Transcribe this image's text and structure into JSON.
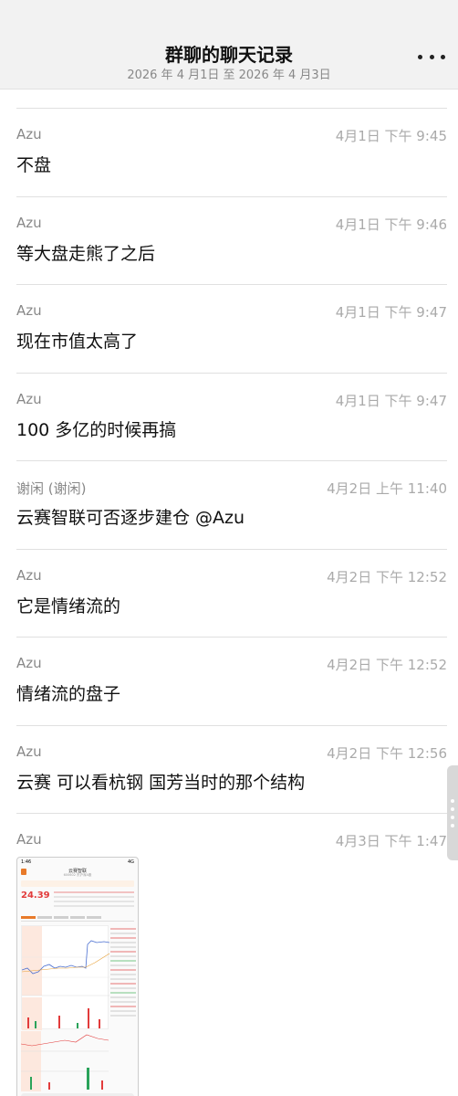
{
  "header": {
    "title": "群聊的聊天记录",
    "subtitle": "2026 年 4 月1日 至 2026 年 4 月3日",
    "more_icon": "more-horizontal-icon"
  },
  "messages": [
    {
      "sender": "Azu",
      "time": "4月1日 下午 9:45",
      "text": "不盘"
    },
    {
      "sender": "Azu",
      "time": "4月1日 下午 9:46",
      "text": "等大盘走熊了之后"
    },
    {
      "sender": "Azu",
      "time": "4月1日 下午 9:47",
      "text": "现在市值太高了"
    },
    {
      "sender": "Azu",
      "time": "4月1日 下午 9:47",
      "text": "100 多亿的时候再搞"
    },
    {
      "sender": "谢闲 (谢闲)",
      "time": "4月2日 上午 11:40",
      "text": "云赛智联可否逐步建仓 @Azu"
    },
    {
      "sender": "Azu",
      "time": "4月2日 下午 12:52",
      "text": "它是情绪流的"
    },
    {
      "sender": "Azu",
      "time": "4月2日 下午 12:52",
      "text": "情绪流的盘子"
    },
    {
      "sender": "Azu",
      "time": "4月2日 下午 12:56",
      "text": "云赛 可以看杭钢 国芳当时的那个结构"
    }
  ],
  "image_message": {
    "sender": "Azu",
    "time": "4月3日 下午 1:47",
    "screenshot": {
      "status_time": "1:46",
      "signal": "4G",
      "stock_name": "云赛智联",
      "stock_code": "600602 东沪深A股",
      "price": "24.39",
      "accent_color": "#e87a2a",
      "up_color": "#e23b3b"
    }
  },
  "scroll_handle_icon": "drag-handle-icon"
}
